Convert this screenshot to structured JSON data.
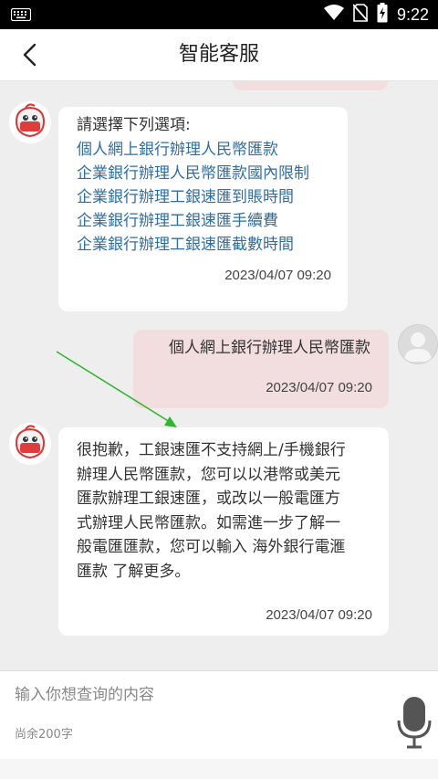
{
  "status_bar": {
    "time": "9:22"
  },
  "header": {
    "title": "智能客服"
  },
  "messages": {
    "bot1": {
      "prompt": "請選擇下列選項:",
      "options": [
        "個人網上銀行辦理人民幣匯款",
        "企業銀行辦理人民幣匯款國內限制",
        "企業銀行辦理工銀速匯到賬時間",
        "企業銀行辦理工銀速匯手續費",
        "企業銀行辦理工銀速匯截數時間"
      ],
      "time": "2023/04/07 09:20"
    },
    "user1": {
      "text": "個人網上銀行辦理人民幣匯款",
      "time": "2023/04/07 09:20"
    },
    "bot2": {
      "lines": [
        "很抱歉，工銀速匯不支持網上/手機銀行",
        "辦理人民幣匯款，您可以以港幣或美元",
        "匯款辦理工銀速匯，或改以一般電匯方",
        "式辦理人民幣匯款。如需進一步了解一",
        "般電匯匯款，您可以輸入 海外銀行電滙",
        "匯款 了解更多。"
      ],
      "time": "2023/04/07 09:20"
    }
  },
  "input": {
    "placeholder": "输入你想查询的内容",
    "remaining": "尚余200字"
  },
  "colors": {
    "accent_link": "#2f6ea5",
    "user_bubble": "#f2dede",
    "arrow": "#2db82d"
  }
}
